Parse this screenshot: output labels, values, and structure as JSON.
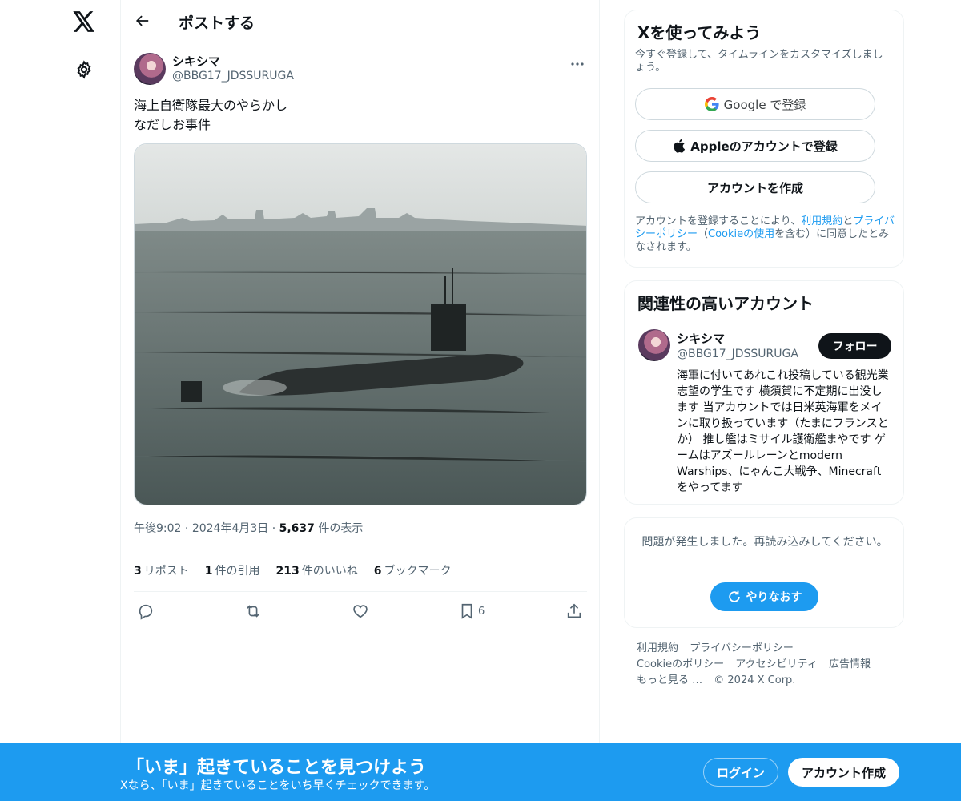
{
  "nav": {
    "logo_icon": "x-logo-icon",
    "settings_icon": "gear-icon"
  },
  "header": {
    "title": "ポストする",
    "back_icon": "arrow-left-icon"
  },
  "post": {
    "author_name": "シキシマ",
    "author_handle": "@BBG17_JDSSURUGA",
    "text_lines": [
      "海上自衛隊最大のやらかし",
      "なだしお事件"
    ],
    "time": "午後9:02",
    "date": "2024年4月3日",
    "views_count": "5,637",
    "views_label": "件の表示",
    "dot": "·",
    "stats": {
      "reposts_count": "3",
      "reposts_label": "リポスト",
      "quotes_count": "1",
      "quotes_label": "件の引用",
      "likes_count": "213",
      "likes_label": "件のいいね",
      "bookmarks_count": "6",
      "bookmarks_label": "ブックマーク"
    },
    "bookmark_action_count": "6"
  },
  "signup_card": {
    "title": "Xを使ってみよう",
    "subtitle": "今すぐ登録して、タイムラインをカスタマイズしましょう。",
    "google_label": "Google で登録",
    "apple_label": "Appleのアカウントで登録",
    "create_label": "アカウントを作成",
    "legal_prefix": "アカウントを登録することにより、",
    "terms_link": "利用規約",
    "and": "と",
    "privacy_link": "プライバシーポリシー",
    "paren_open": "（",
    "cookie_link": "Cookieの使用",
    "legal_suffix": "を含む）に同意したとみなされます。"
  },
  "related_card": {
    "title": "関連性の高いアカウント",
    "name": "シキシマ",
    "handle": "@BBG17_JDSSURUGA",
    "follow_label": "フォロー",
    "bio": "海軍に付いてあれこれ投稿している観光業志望の学生です 横須賀に不定期に出没します 当アカウントでは日米英海軍をメインに取り扱っています（たまにフランスとか） 推し艦はミサイル護衛艦まやです ゲームはアズールレーンとmodern Warships、にゃんこ大戦争、Minecraftをやってます"
  },
  "error_card": {
    "message": "問題が発生しました。再読み込みしてください。",
    "retry_label": "やりなおす"
  },
  "footer": {
    "links": [
      "利用規約",
      "プライバシーポリシー",
      "Cookieのポリシー",
      "アクセシビリティ",
      "広告情報",
      "もっと見る …",
      "© 2024 X Corp."
    ]
  },
  "bottom_bar": {
    "title": "「いま」起きていることを見つけよう",
    "subtitle": "Xなら、「いま」起きていることをいち早くチェックできます。",
    "login_label": "ログイン",
    "signup_label": "アカウント作成"
  },
  "colors": {
    "accent": "#1d9bf0",
    "text": "#0f1419",
    "muted": "#536471",
    "border": "#eff3f4"
  }
}
